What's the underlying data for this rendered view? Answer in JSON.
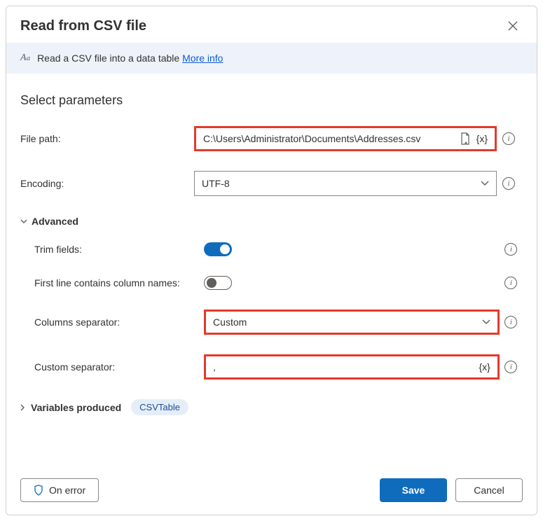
{
  "dialog": {
    "title": "Read from CSV file",
    "banner_text": "Read a CSV file into a data table ",
    "banner_link": "More info"
  },
  "section_heading": "Select parameters",
  "fields": {
    "file_path": {
      "label": "File path:",
      "value": "C:\\Users\\Administrator\\Documents\\Addresses.csv"
    },
    "encoding": {
      "label": "Encoding:",
      "value": "UTF-8"
    }
  },
  "advanced": {
    "heading": "Advanced",
    "trim_fields": {
      "label": "Trim fields:",
      "on": true
    },
    "first_line": {
      "label": "First line contains column names:",
      "on": false
    },
    "columns_sep": {
      "label": "Columns separator:",
      "value": "Custom"
    },
    "custom_sep": {
      "label": "Custom separator:",
      "value": ","
    }
  },
  "variables": {
    "label": "Variables produced",
    "pill": "CSVTable"
  },
  "footer": {
    "on_error": "On error",
    "save": "Save",
    "cancel": "Cancel"
  }
}
